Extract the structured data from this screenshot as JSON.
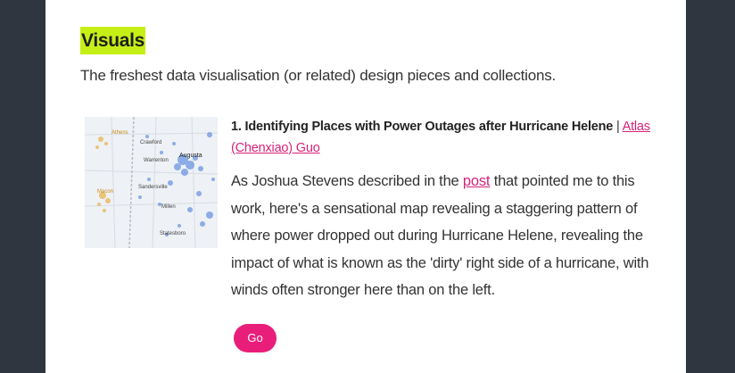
{
  "section": {
    "title": "Visuals",
    "description": "The freshest data visualisation (or related) design pieces and collections."
  },
  "item": {
    "number_title": "1. Identifying Places with Power Outages after Hurricane Helene",
    "separator": " | ",
    "author_link": "Atlas (Chenxiao) Guo",
    "body_before": "As Joshua Stevens described in the ",
    "body_link": "post",
    "body_after": " that pointed me to this work, here's a sensational map revealing a staggering pattern of where power dropped out during Hurricane Helene, revealing the impact of what is known as the 'dirty' right side of a hurricane, with winds often stronger here than on the left.",
    "go_label": "Go",
    "thumbnail": {
      "alt_icon": "map-thumbnail",
      "labels": [
        "Athens",
        "Augusta",
        "Macon"
      ]
    }
  },
  "colors": {
    "page_bg": "#2f3640",
    "card_bg": "#ffffff",
    "highlight": "#c6ef16",
    "link": "#d6227a",
    "button": "#e91e7a"
  }
}
